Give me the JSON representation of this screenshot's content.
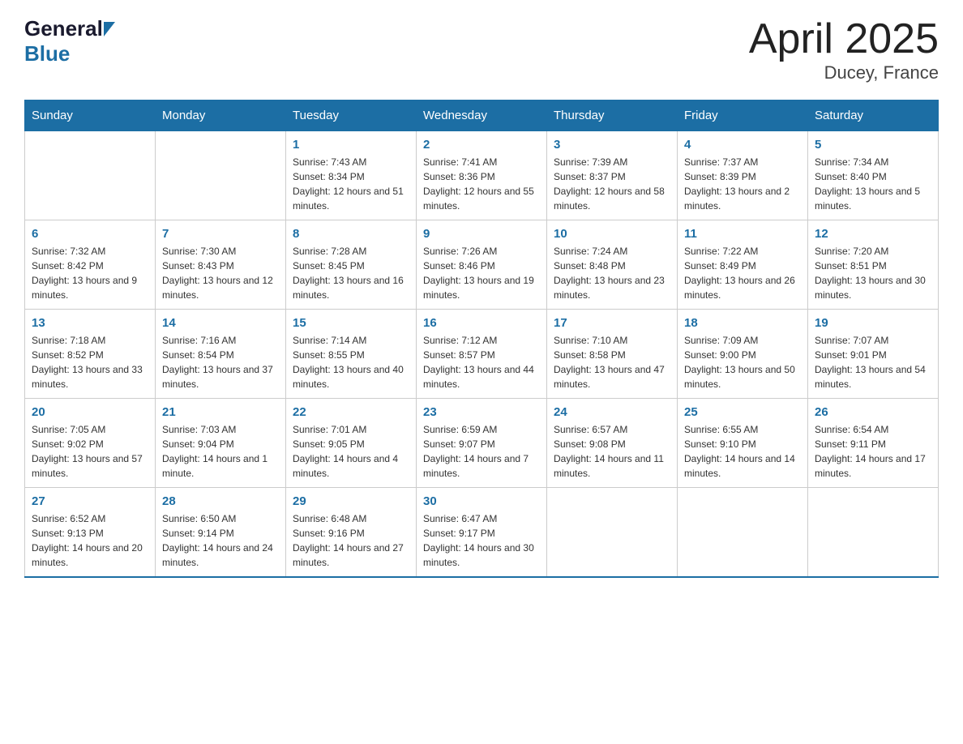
{
  "header": {
    "logo_general": "General",
    "logo_blue": "Blue",
    "title": "April 2025",
    "subtitle": "Ducey, France"
  },
  "calendar": {
    "days_of_week": [
      "Sunday",
      "Monday",
      "Tuesday",
      "Wednesday",
      "Thursday",
      "Friday",
      "Saturday"
    ],
    "weeks": [
      [
        {
          "day": "",
          "info": ""
        },
        {
          "day": "",
          "info": ""
        },
        {
          "day": "1",
          "sunrise": "7:43 AM",
          "sunset": "8:34 PM",
          "daylight": "12 hours and 51 minutes."
        },
        {
          "day": "2",
          "sunrise": "7:41 AM",
          "sunset": "8:36 PM",
          "daylight": "12 hours and 55 minutes."
        },
        {
          "day": "3",
          "sunrise": "7:39 AM",
          "sunset": "8:37 PM",
          "daylight": "12 hours and 58 minutes."
        },
        {
          "day": "4",
          "sunrise": "7:37 AM",
          "sunset": "8:39 PM",
          "daylight": "13 hours and 2 minutes."
        },
        {
          "day": "5",
          "sunrise": "7:34 AM",
          "sunset": "8:40 PM",
          "daylight": "13 hours and 5 minutes."
        }
      ],
      [
        {
          "day": "6",
          "sunrise": "7:32 AM",
          "sunset": "8:42 PM",
          "daylight": "13 hours and 9 minutes."
        },
        {
          "day": "7",
          "sunrise": "7:30 AM",
          "sunset": "8:43 PM",
          "daylight": "13 hours and 12 minutes."
        },
        {
          "day": "8",
          "sunrise": "7:28 AM",
          "sunset": "8:45 PM",
          "daylight": "13 hours and 16 minutes."
        },
        {
          "day": "9",
          "sunrise": "7:26 AM",
          "sunset": "8:46 PM",
          "daylight": "13 hours and 19 minutes."
        },
        {
          "day": "10",
          "sunrise": "7:24 AM",
          "sunset": "8:48 PM",
          "daylight": "13 hours and 23 minutes."
        },
        {
          "day": "11",
          "sunrise": "7:22 AM",
          "sunset": "8:49 PM",
          "daylight": "13 hours and 26 minutes."
        },
        {
          "day": "12",
          "sunrise": "7:20 AM",
          "sunset": "8:51 PM",
          "daylight": "13 hours and 30 minutes."
        }
      ],
      [
        {
          "day": "13",
          "sunrise": "7:18 AM",
          "sunset": "8:52 PM",
          "daylight": "13 hours and 33 minutes."
        },
        {
          "day": "14",
          "sunrise": "7:16 AM",
          "sunset": "8:54 PM",
          "daylight": "13 hours and 37 minutes."
        },
        {
          "day": "15",
          "sunrise": "7:14 AM",
          "sunset": "8:55 PM",
          "daylight": "13 hours and 40 minutes."
        },
        {
          "day": "16",
          "sunrise": "7:12 AM",
          "sunset": "8:57 PM",
          "daylight": "13 hours and 44 minutes."
        },
        {
          "day": "17",
          "sunrise": "7:10 AM",
          "sunset": "8:58 PM",
          "daylight": "13 hours and 47 minutes."
        },
        {
          "day": "18",
          "sunrise": "7:09 AM",
          "sunset": "9:00 PM",
          "daylight": "13 hours and 50 minutes."
        },
        {
          "day": "19",
          "sunrise": "7:07 AM",
          "sunset": "9:01 PM",
          "daylight": "13 hours and 54 minutes."
        }
      ],
      [
        {
          "day": "20",
          "sunrise": "7:05 AM",
          "sunset": "9:02 PM",
          "daylight": "13 hours and 57 minutes."
        },
        {
          "day": "21",
          "sunrise": "7:03 AM",
          "sunset": "9:04 PM",
          "daylight": "14 hours and 1 minute."
        },
        {
          "day": "22",
          "sunrise": "7:01 AM",
          "sunset": "9:05 PM",
          "daylight": "14 hours and 4 minutes."
        },
        {
          "day": "23",
          "sunrise": "6:59 AM",
          "sunset": "9:07 PM",
          "daylight": "14 hours and 7 minutes."
        },
        {
          "day": "24",
          "sunrise": "6:57 AM",
          "sunset": "9:08 PM",
          "daylight": "14 hours and 11 minutes."
        },
        {
          "day": "25",
          "sunrise": "6:55 AM",
          "sunset": "9:10 PM",
          "daylight": "14 hours and 14 minutes."
        },
        {
          "day": "26",
          "sunrise": "6:54 AM",
          "sunset": "9:11 PM",
          "daylight": "14 hours and 17 minutes."
        }
      ],
      [
        {
          "day": "27",
          "sunrise": "6:52 AM",
          "sunset": "9:13 PM",
          "daylight": "14 hours and 20 minutes."
        },
        {
          "day": "28",
          "sunrise": "6:50 AM",
          "sunset": "9:14 PM",
          "daylight": "14 hours and 24 minutes."
        },
        {
          "day": "29",
          "sunrise": "6:48 AM",
          "sunset": "9:16 PM",
          "daylight": "14 hours and 27 minutes."
        },
        {
          "day": "30",
          "sunrise": "6:47 AM",
          "sunset": "9:17 PM",
          "daylight": "14 hours and 30 minutes."
        },
        {
          "day": "",
          "info": ""
        },
        {
          "day": "",
          "info": ""
        },
        {
          "day": "",
          "info": ""
        }
      ]
    ],
    "labels": {
      "sunrise": "Sunrise: ",
      "sunset": "Sunset: ",
      "daylight": "Daylight: "
    }
  }
}
